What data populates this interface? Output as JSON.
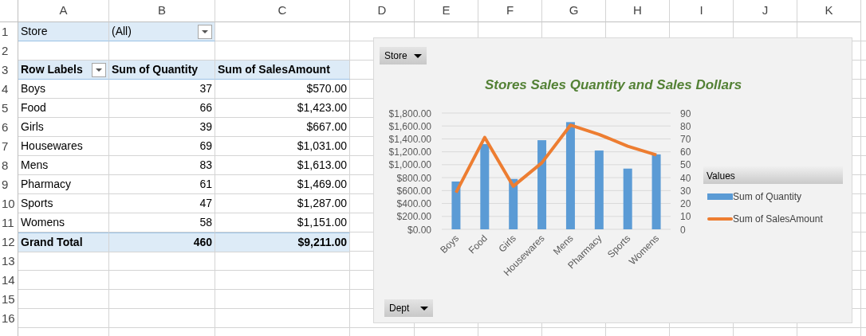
{
  "column_headers": [
    "A",
    "B",
    "C",
    "D",
    "E",
    "F",
    "G",
    "H",
    "I",
    "J",
    "K"
  ],
  "row_numbers": [
    "1",
    "2",
    "3",
    "4",
    "5",
    "6",
    "7",
    "8",
    "9",
    "10",
    "11",
    "12",
    "13",
    "14",
    "15",
    "16"
  ],
  "report_filter": {
    "label": "Store",
    "value": "(All)"
  },
  "pivot": {
    "row_header": "Row Labels",
    "columns": [
      "Sum of Quantity",
      "Sum of SalesAmount"
    ],
    "rows": [
      {
        "label": "Boys",
        "quantity": "37",
        "sales": "$570.00"
      },
      {
        "label": "Food",
        "quantity": "66",
        "sales": "$1,423.00"
      },
      {
        "label": "Girls",
        "quantity": "39",
        "sales": "$667.00"
      },
      {
        "label": "Housewares",
        "quantity": "69",
        "sales": "$1,031.00"
      },
      {
        "label": "Mens",
        "quantity": "83",
        "sales": "$1,613.00"
      },
      {
        "label": "Pharmacy",
        "quantity": "61",
        "sales": "$1,469.00"
      },
      {
        "label": "Sports",
        "quantity": "47",
        "sales": "$1,287.00"
      },
      {
        "label": "Womens",
        "quantity": "58",
        "sales": "$1,151.00"
      }
    ],
    "total": {
      "label": "Grand Total",
      "quantity": "460",
      "sales": "$9,211.00"
    }
  },
  "chart": {
    "filter_button": "Store",
    "axis_button": "Dept",
    "legend_title": "Values",
    "chart_data": {
      "type": "bar",
      "title": "Stores Sales Quantity and Sales Dollars",
      "categories": [
        "Boys",
        "Food",
        "Girls",
        "Housewares",
        "Mens",
        "Pharmacy",
        "Sports",
        "Womens"
      ],
      "series": [
        {
          "name": "Sum of Quantity",
          "color": "#5b9bd5",
          "type": "bar",
          "axis": "y2",
          "values": [
            37,
            66,
            39,
            69,
            83,
            61,
            47,
            58
          ]
        },
        {
          "name": "Sum of SalesAmount",
          "color": "#ed7d31",
          "type": "line",
          "values": [
            570,
            1423,
            667,
            1031,
            1613,
            1469,
            1287,
            1151
          ]
        }
      ],
      "ylim": [
        0,
        1800
      ],
      "yticks": [
        {
          "value": 0,
          "label": "$0.00"
        },
        {
          "value": 200,
          "label": "$200.00"
        },
        {
          "value": 400,
          "label": "$400.00"
        },
        {
          "value": 600,
          "label": "$600.00"
        },
        {
          "value": 800,
          "label": "$800.00"
        },
        {
          "value": 1000,
          "label": "$1,000.00"
        },
        {
          "value": 1200,
          "label": "$1,200.00"
        },
        {
          "value": 1400,
          "label": "$1,400.00"
        },
        {
          "value": 1600,
          "label": "$1,600.00"
        },
        {
          "value": 1800,
          "label": "$1,800.00"
        }
      ],
      "y2lim": [
        0,
        90
      ],
      "y2ticks": [
        0,
        10,
        20,
        30,
        40,
        50,
        60,
        70,
        80,
        90
      ],
      "grid": true
    }
  }
}
